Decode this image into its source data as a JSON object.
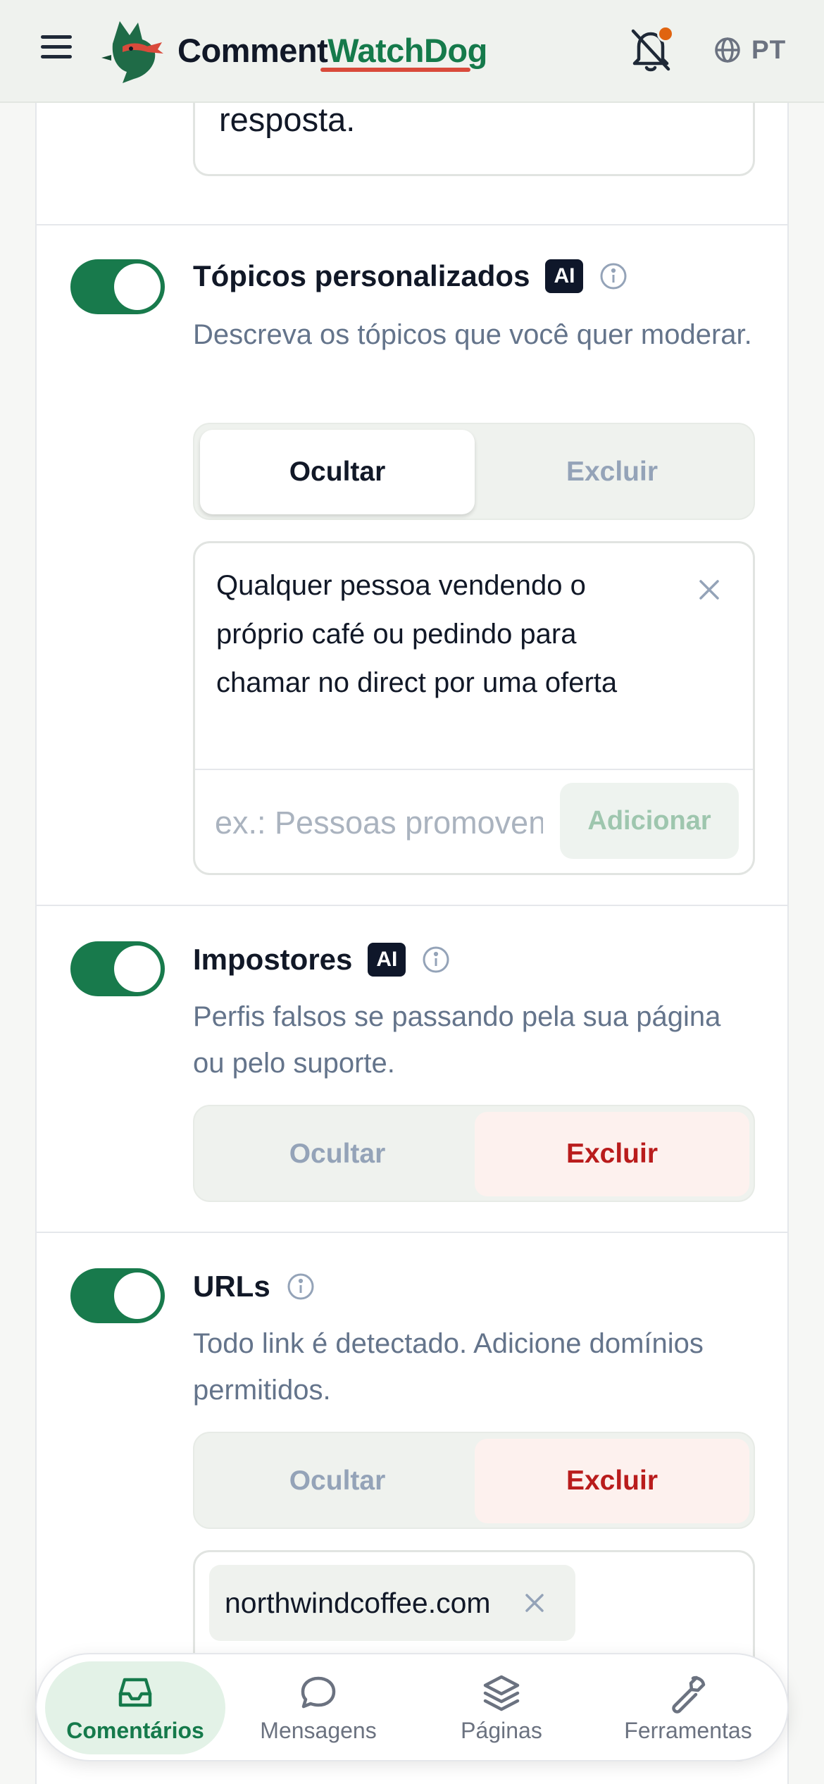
{
  "header": {
    "brand_part1": "Comment",
    "brand_part2": "WatchDog",
    "language": "PT",
    "icons": [
      "menu-icon",
      "dog-logo",
      "bell-off-icon",
      "globe-icon"
    ],
    "brand_accent_color": "#157a4b",
    "notification_dot_color": "#e06410"
  },
  "previous_box": {
    "text_tail": "resposta."
  },
  "rules": [
    {
      "title": "Tópicos personalizados",
      "ai_badge": "AI",
      "enabled": true,
      "description": "Descreva os tópicos que você quer moderar.",
      "action_options": [
        "Ocultar",
        "Excluir"
      ],
      "selected_action": "Ocultar",
      "topics": [
        "Qualquer pessoa vendendo o próprio café ou pedindo para chamar no direct por uma oferta"
      ],
      "input_placeholder": "ex.: Pessoas promovendo produtos concorrentes",
      "add_label": "Adicionar"
    },
    {
      "title": "Impostores",
      "ai_badge": "AI",
      "enabled": true,
      "description": "Perfis falsos se passando pela sua página ou pelo suporte.",
      "action_options": [
        "Ocultar",
        "Excluir"
      ],
      "selected_action": "Excluir"
    },
    {
      "title": "URLs",
      "enabled": true,
      "description": "Todo link é detectado. Adicione domínios permitidos.",
      "action_options": [
        "Ocultar",
        "Excluir"
      ],
      "selected_action": "Excluir",
      "allowed_domains": [
        "northwindcoffee.com"
      ]
    }
  ],
  "bottom_nav": {
    "items": [
      {
        "label": "Comentários",
        "icon": "inbox-icon",
        "active": true
      },
      {
        "label": "Mensagens",
        "icon": "chat-bubble-icon",
        "active": false
      },
      {
        "label": "Páginas",
        "icon": "layers-icon",
        "active": false
      },
      {
        "label": "Ferramentas",
        "icon": "wrench-icon",
        "active": false
      }
    ]
  },
  "colors": {
    "toggle_on": "#187a4c",
    "danger_text": "#b91c1c",
    "danger_bg": "#fdf1ee"
  }
}
